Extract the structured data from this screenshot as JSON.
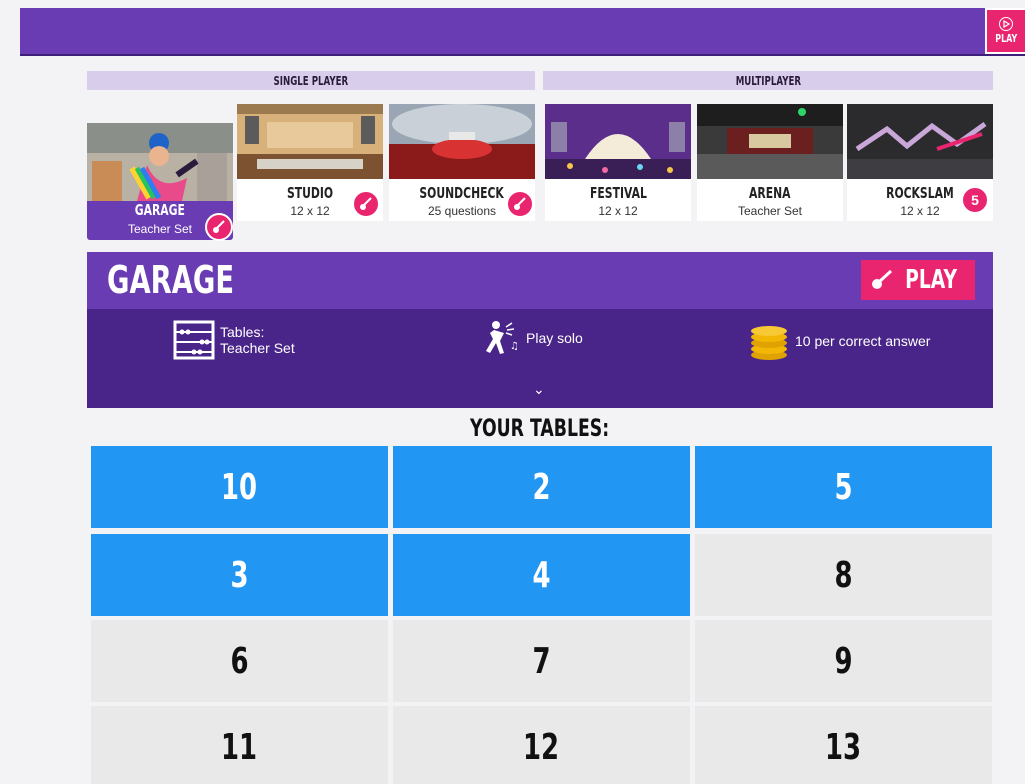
{
  "top_play": {
    "label": "PLAY"
  },
  "sections": {
    "single": "SINGLE PLAYER",
    "multi": "MULTIPLAYER"
  },
  "modes": [
    {
      "name": "GARAGE",
      "sub": "Teacher Set",
      "selected": true
    },
    {
      "name": "STUDIO",
      "sub": "12 x 12"
    },
    {
      "name": "SOUNDCHECK",
      "sub": "25 questions"
    },
    {
      "name": "FESTIVAL",
      "sub": "12 x 12"
    },
    {
      "name": "ARENA",
      "sub": "Teacher Set"
    },
    {
      "name": "ROCKSLAM",
      "sub": "12 x 12",
      "badge": "5"
    }
  ],
  "banner": {
    "title": "GARAGE",
    "play_label": "PLAY"
  },
  "info": {
    "tables_label": "Tables:",
    "tables_value": "Teacher Set",
    "mode": "Play solo",
    "coins": "10 per correct answer"
  },
  "your_tables": {
    "heading": "YOUR TABLES:",
    "tiles": [
      {
        "label": "10",
        "selected": true
      },
      {
        "label": "2",
        "selected": true
      },
      {
        "label": "5",
        "selected": true
      },
      {
        "label": "3",
        "selected": true
      },
      {
        "label": "4",
        "selected": true
      },
      {
        "label": "8",
        "selected": false
      },
      {
        "label": "6",
        "selected": false
      },
      {
        "label": "7",
        "selected": false
      },
      {
        "label": "9",
        "selected": false
      },
      {
        "label": "11",
        "selected": false
      },
      {
        "label": "12",
        "selected": false
      },
      {
        "label": "13",
        "selected": false
      }
    ]
  },
  "colors": {
    "purple": "#6a3cb4",
    "dark_purple": "#4a2589",
    "pink": "#e8256e",
    "blue": "#2196f3",
    "grey_tile": "#e9e9e9"
  }
}
